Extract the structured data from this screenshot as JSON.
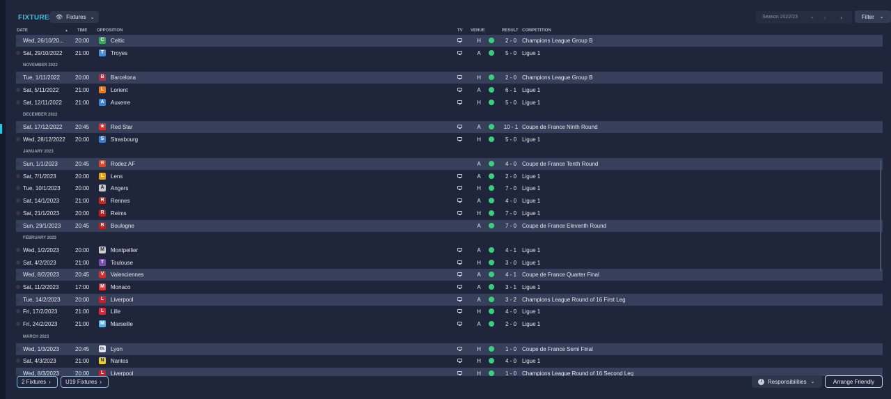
{
  "page": {
    "title": "FIXTURES",
    "view_dropdown": "Fixtures",
    "season_selector": "Season 2022/23",
    "filter_label": "Filter"
  },
  "columns": {
    "date": "DATE",
    "time": "TIME",
    "opposition": "OPPOSITION",
    "tv": "TV",
    "venue": "VENUE",
    "result": "RESULT",
    "competition": "COMPETITION"
  },
  "months": [
    "NOVEMBER 2022",
    "DECEMBER 2022",
    "JANUARY 2023",
    "FEBRUARY 2023",
    "MARCH 2023"
  ],
  "fixtures": [
    {
      "date": "Wed, 26/10/20...",
      "time": "20:00",
      "opp": "Celtic",
      "tv": true,
      "venue": "H",
      "result": "2 - 0",
      "comp": "Champions League Group B",
      "hl": true,
      "crest_color": "#3ca65a",
      "crest": "C"
    },
    {
      "date": "Sat, 29/10/2022",
      "time": "21:00",
      "opp": "Troyes",
      "tv": true,
      "venue": "A",
      "result": "5 - 0",
      "comp": "Ligue 1",
      "hl": false,
      "crest_color": "#4a8fd6",
      "crest": "T"
    },
    {
      "date": "Tue, 1/11/2022",
      "time": "20:00",
      "opp": "Barcelona",
      "tv": true,
      "venue": "H",
      "result": "2 - 0",
      "comp": "Champions League Group B",
      "hl": true,
      "crest_color": "#a8324a",
      "crest": "B"
    },
    {
      "date": "Sat, 5/11/2022",
      "time": "21:00",
      "opp": "Lorient",
      "tv": true,
      "venue": "A",
      "result": "6 - 1",
      "comp": "Ligue 1",
      "hl": false,
      "crest_color": "#e07a24",
      "crest": "L"
    },
    {
      "date": "Sat, 12/11/2022",
      "time": "21:00",
      "opp": "Auxerre",
      "tv": true,
      "venue": "H",
      "result": "5 - 0",
      "comp": "Ligue 1",
      "hl": false,
      "crest_color": "#3a86d4",
      "crest": "A"
    },
    {
      "date": "Sat, 17/12/2022",
      "time": "20:45",
      "opp": "Red Star",
      "tv": true,
      "venue": "A",
      "result": "10 - 1",
      "comp": "Coupe de France Ninth Round",
      "hl": true,
      "crest_color": "#d83030",
      "crest": "★"
    },
    {
      "date": "Wed, 28/12/2022",
      "time": "20:00",
      "opp": "Strasbourg",
      "tv": true,
      "venue": "H",
      "result": "5 - 0",
      "comp": "Ligue 1",
      "hl": false,
      "crest_color": "#3a7fd0",
      "crest": "S"
    },
    {
      "date": "Sun, 1/1/2023",
      "time": "20:45",
      "opp": "Rodez AF",
      "tv": false,
      "venue": "A",
      "result": "4 - 0",
      "comp": "Coupe de France Tenth Round",
      "hl": true,
      "crest_color": "#d8462a",
      "crest": "R"
    },
    {
      "date": "Sat, 7/1/2023",
      "time": "20:00",
      "opp": "Lens",
      "tv": true,
      "venue": "A",
      "result": "2 - 0",
      "comp": "Ligue 1",
      "hl": false,
      "crest_color": "#e0a020",
      "crest": "L"
    },
    {
      "date": "Tue, 10/1/2023",
      "time": "20:00",
      "opp": "Angers",
      "tv": true,
      "venue": "H",
      "result": "7 - 0",
      "comp": "Ligue 1",
      "hl": false,
      "crest_color": "#c8c8c8",
      "crest": "A"
    },
    {
      "date": "Sat, 14/1/2023",
      "time": "21:00",
      "opp": "Rennes",
      "tv": true,
      "venue": "A",
      "result": "4 - 0",
      "comp": "Ligue 1",
      "hl": false,
      "crest_color": "#c42a24",
      "crest": "R"
    },
    {
      "date": "Sat, 21/1/2023",
      "time": "20:00",
      "opp": "Reims",
      "tv": true,
      "venue": "H",
      "result": "7 - 0",
      "comp": "Ligue 1",
      "hl": false,
      "crest_color": "#b82020",
      "crest": "R"
    },
    {
      "date": "Sun, 29/1/2023",
      "time": "20:45",
      "opp": "Boulogne",
      "tv": false,
      "venue": "A",
      "result": "7 - 0",
      "comp": "Coupe de France Eleventh Round",
      "hl": true,
      "crest_color": "#c02020",
      "crest": "B"
    },
    {
      "date": "Wed, 1/2/2023",
      "time": "20:00",
      "opp": "Montpellier",
      "tv": true,
      "venue": "A",
      "result": "4 - 1",
      "comp": "Ligue 1",
      "hl": false,
      "crest_color": "#cfcfcf",
      "crest": "M"
    },
    {
      "date": "Sat, 4/2/2023",
      "time": "21:00",
      "opp": "Toulouse",
      "tv": true,
      "venue": "H",
      "result": "3 - 0",
      "comp": "Ligue 1",
      "hl": false,
      "crest_color": "#7a4fb0",
      "crest": "T"
    },
    {
      "date": "Wed, 8/2/2023",
      "time": "20:45",
      "opp": "Valenciennes",
      "tv": true,
      "venue": "A",
      "result": "4 - 1",
      "comp": "Coupe de France Quarter Final",
      "hl": true,
      "crest_color": "#d03030",
      "crest": "V"
    },
    {
      "date": "Sat, 11/2/2023",
      "time": "17:00",
      "opp": "Monaco",
      "tv": true,
      "venue": "A",
      "result": "3 - 1",
      "comp": "Ligue 1",
      "hl": false,
      "crest_color": "#d83a3a",
      "crest": "M"
    },
    {
      "date": "Tue, 14/2/2023",
      "time": "20:00",
      "opp": "Liverpool",
      "tv": true,
      "venue": "A",
      "result": "3 - 2",
      "comp": "Champions League Round of 16 First Leg",
      "hl": true,
      "crest_color": "#c82030",
      "crest": "L"
    },
    {
      "date": "Fri, 17/2/2023",
      "time": "21:00",
      "opp": "Lille",
      "tv": true,
      "venue": "H",
      "result": "4 - 0",
      "comp": "Ligue 1",
      "hl": false,
      "crest_color": "#d82a3a",
      "crest": "L"
    },
    {
      "date": "Fri, 24/2/2023",
      "time": "21:00",
      "opp": "Marseille",
      "tv": true,
      "venue": "A",
      "result": "2 - 0",
      "comp": "Ligue 1",
      "hl": false,
      "crest_color": "#5ab4e8",
      "crest": "M"
    },
    {
      "date": "Wed, 1/3/2023",
      "time": "20:45",
      "opp": "Lyon",
      "tv": true,
      "venue": "H",
      "result": "1 - 0",
      "comp": "Coupe de France Semi Final",
      "hl": true,
      "crest_color": "#e8e8f0",
      "crest": "OL"
    },
    {
      "date": "Sat, 4/3/2023",
      "time": "21:00",
      "opp": "Nantes",
      "tv": true,
      "venue": "H",
      "result": "4 - 0",
      "comp": "Ligue 1",
      "hl": false,
      "crest_color": "#e8d030",
      "crest": "N"
    },
    {
      "date": "Wed, 8/3/2023",
      "time": "20:00",
      "opp": "Liverpool",
      "tv": true,
      "venue": "H",
      "result": "1 - 0",
      "comp": "Champions League Round of 16 Second Leg",
      "hl": true,
      "crest_color": "#c82030",
      "crest": "L"
    }
  ],
  "footer": {
    "fixtures_link": "2 Fixtures",
    "u19_link": "U19 Fixtures",
    "responsibilities": "Responsibilities",
    "arrange_friendly": "Arrange Friendly"
  },
  "colors": {
    "accent": "#2fc4e0",
    "win": "#3bd080",
    "highlight_row": "#36405a",
    "background": "#1f263b"
  }
}
